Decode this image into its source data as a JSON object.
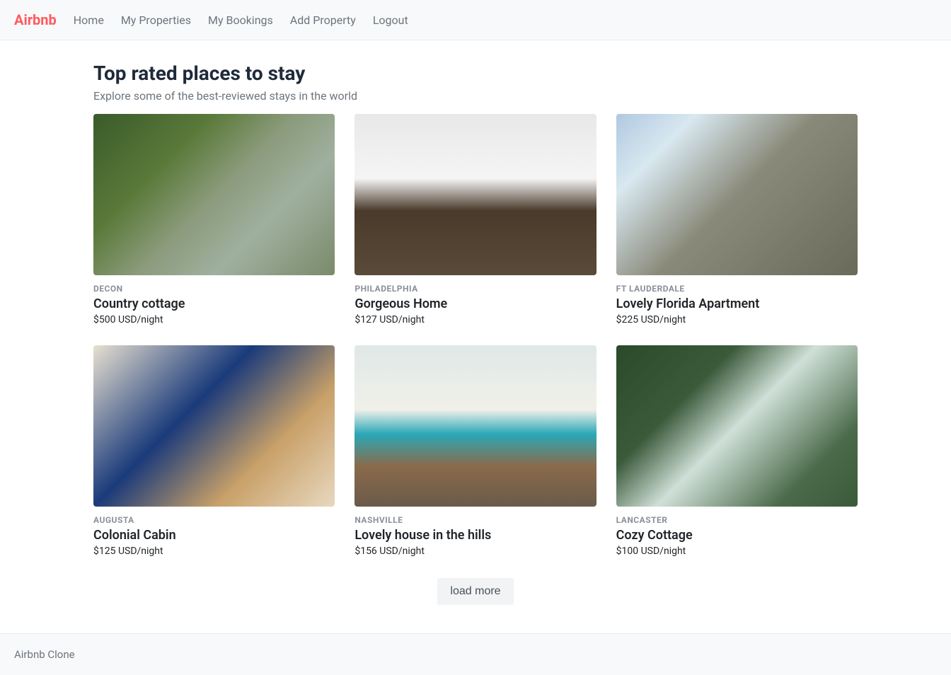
{
  "logo": "Airbnb",
  "nav": {
    "home": "Home",
    "my_properties": "My Properties",
    "my_bookings": "My Bookings",
    "add_property": "Add Property",
    "logout": "Logout"
  },
  "page": {
    "title": "Top rated places to stay",
    "subtitle": "Explore some of the best-reviewed stays in the world"
  },
  "listings": [
    {
      "location": "DECON",
      "title": "Country cottage",
      "price": "$500 USD/night"
    },
    {
      "location": "PHILADELPHIA",
      "title": "Gorgeous Home",
      "price": "$127 USD/night"
    },
    {
      "location": "FT LAUDERDALE",
      "title": "Lovely Florida Apartment",
      "price": "$225 USD/night"
    },
    {
      "location": "AUGUSTA",
      "title": "Colonial Cabin",
      "price": "$125 USD/night"
    },
    {
      "location": "NASHVILLE",
      "title": "Lovely house in the hills",
      "price": "$156 USD/night"
    },
    {
      "location": "LANCASTER",
      "title": "Cozy Cottage",
      "price": "$100 USD/night"
    }
  ],
  "load_more": "load more",
  "footer": "Airbnb Clone"
}
